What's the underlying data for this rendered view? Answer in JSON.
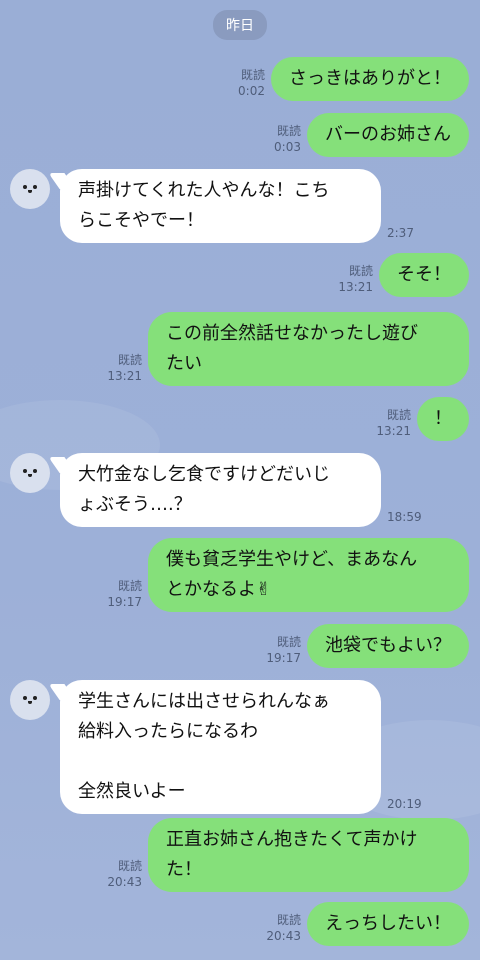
{
  "date_label": "昨日",
  "read_label": "既読",
  "messages": [
    {
      "dir": "out",
      "text": "さっきはありがと！",
      "time": "0:02"
    },
    {
      "dir": "out",
      "text": "バーのお姉さん",
      "time": "0:03"
    },
    {
      "dir": "in",
      "lines": [
        "声掛けてくれた人やんな！こち",
        "らこそやでー！"
      ],
      "time": "2:37"
    },
    {
      "dir": "out",
      "text": "そそ！",
      "time": "13:21"
    },
    {
      "dir": "out",
      "lines": [
        "この前全然話せなかったし遊び",
        "たい"
      ],
      "time": "13:21"
    },
    {
      "dir": "out",
      "text": "！",
      "time": "13:21"
    },
    {
      "dir": "in",
      "lines": [
        "大竹金なし乞食ですけどだいじ",
        "ょぶそう….？"
      ],
      "time": "18:59"
    },
    {
      "dir": "out",
      "lines": [
        "僕も貧乏学生やけど、まあなん",
        "とかなるよ✌"
      ],
      "time": "19:17"
    },
    {
      "dir": "out",
      "text": "池袋でもよい？",
      "time": "19:17"
    },
    {
      "dir": "in",
      "lines": [
        "学生さんには出させられんなぁ",
        "給料入ったらになるわ",
        "",
        "全然良いよー"
      ],
      "time": "20:19"
    },
    {
      "dir": "out",
      "lines": [
        "正直お姉さん抱きたくて声かけ",
        "た！"
      ],
      "time": "20:43"
    },
    {
      "dir": "out",
      "text": "えっちしたい！",
      "time": "20:43"
    }
  ]
}
